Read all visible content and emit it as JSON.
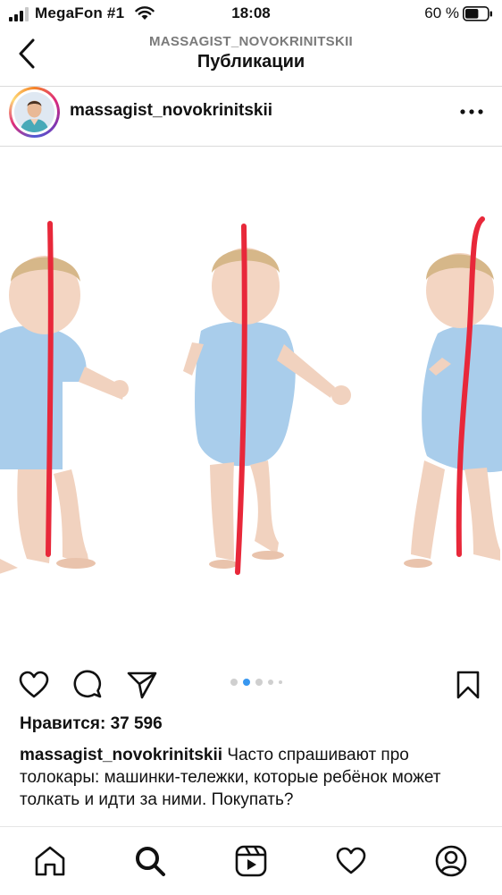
{
  "status_bar": {
    "carrier": "MegaFon #1",
    "time": "18:08",
    "battery_percent": "60 %",
    "battery_level": 0.6,
    "icons": [
      "signal-icon",
      "wifi-icon",
      "battery-icon"
    ]
  },
  "nav": {
    "subtitle": "MASSAGIST_NOVOKRINITSKII",
    "title": "Публикации",
    "back_icon": "chevron-left-icon"
  },
  "post": {
    "username": "massagist_novokrinitskii",
    "more_icon": "more-horizontal-icon",
    "carousel": {
      "total_dots": 5,
      "active_index": 1
    },
    "likes": "Нравится: 37 596",
    "caption_user": "massagist_novokrinitskii",
    "caption_text": "Часто спрашивают про толокары: машинки-тележки, которые ребёнок может толкать и идти за ними. Покупать?",
    "accent_color": "#3897f0",
    "line_color": "#e8283a"
  },
  "tabbar": {
    "items": [
      "home-icon",
      "search-icon",
      "reels-icon",
      "activity-heart-icon",
      "profile-icon"
    ]
  }
}
